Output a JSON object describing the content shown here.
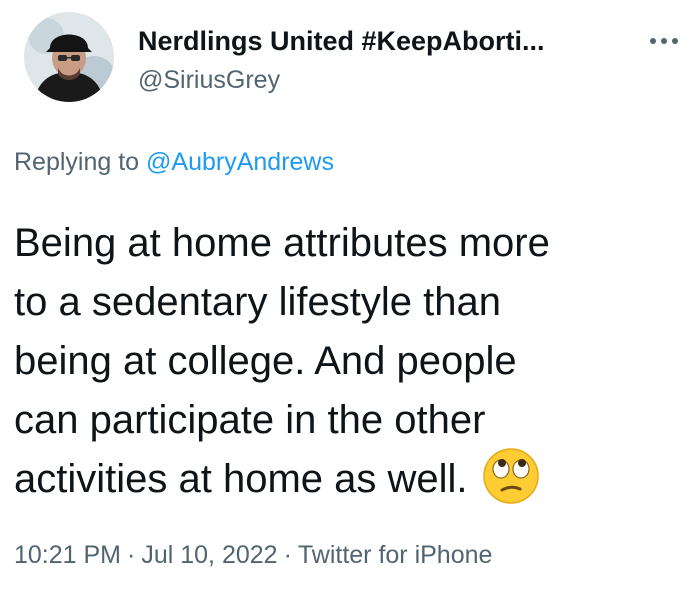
{
  "tweet": {
    "author": {
      "display_name": "Nerdlings United #KeepAborti...",
      "handle": "@SiriusGrey",
      "avatar_icon": "profile-photo-man-in-cap"
    },
    "more_icon": "more-horizontal-icon",
    "reply": {
      "prefix": "Replying to",
      "mention": "@AubryAndrews"
    },
    "text_lines": [
      "Being at home attributes more",
      "to a sedentary lifestyle than",
      "being at college. And people",
      "can participate in the other",
      "activities at home as well."
    ],
    "emoji": "face-with-rolling-eyes",
    "meta": {
      "time": "10:21 PM",
      "date": "Jul 10, 2022",
      "source": "Twitter for iPhone",
      "separator": "·"
    }
  }
}
